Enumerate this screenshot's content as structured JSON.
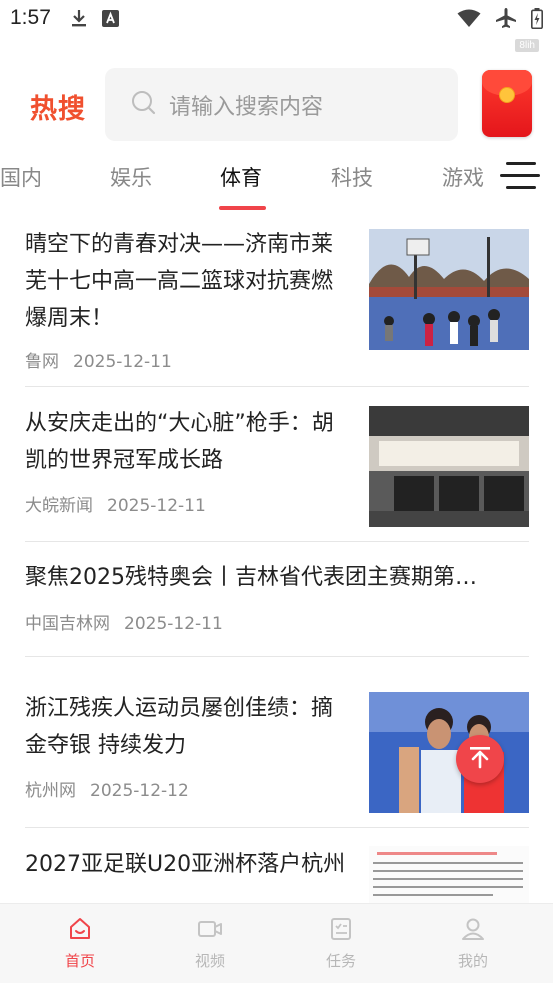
{
  "status_bar": {
    "time": "1:57",
    "speed_tag": "8lih",
    "icons": [
      "download-icon",
      "app-notification-icon",
      "wifi-icon",
      "airplane-icon",
      "battery-icon"
    ]
  },
  "header": {
    "logo": "热搜",
    "search_placeholder": "请输入搜索内容",
    "accent_color": "#f0502f"
  },
  "tabs": [
    {
      "label": "国内"
    },
    {
      "label": "娱乐"
    },
    {
      "label": "体育",
      "active": true
    },
    {
      "label": "科技"
    },
    {
      "label": "游戏"
    }
  ],
  "news": [
    {
      "title": "晴空下的青春对决——济南市莱芜十七中高一高二篮球对抗赛燃爆周末！",
      "source": "鲁网",
      "date": "2025-12-11",
      "has_image": true
    },
    {
      "title": "从安庆走出的“大心脏”枪手：胡凯的世界冠军成长路",
      "source": "大皖新闻",
      "date": "2025-12-11",
      "has_image": true
    },
    {
      "title": "聚焦2025残特奥会丨吉林省代表团主赛期第…",
      "source": "中国吉林网",
      "date": "2025-12-11",
      "has_image": false
    },
    {
      "title": "浙江残疾人运动员屡创佳绩：摘金夺银 持续发力",
      "source": "杭州网",
      "date": "2025-12-12",
      "has_image": true
    },
    {
      "title": "2027亚足联U20亚洲杯落户杭州",
      "source": "",
      "date": "",
      "has_image": true
    }
  ],
  "bottom_nav": [
    {
      "label": "首页",
      "icon": "home-icon",
      "active": true
    },
    {
      "label": "视频",
      "icon": "video-icon"
    },
    {
      "label": "任务",
      "icon": "task-icon"
    },
    {
      "label": "我的",
      "icon": "profile-icon"
    }
  ],
  "colors": {
    "active_red": "#f0454a",
    "inactive_gray": "#b7b7b7"
  }
}
